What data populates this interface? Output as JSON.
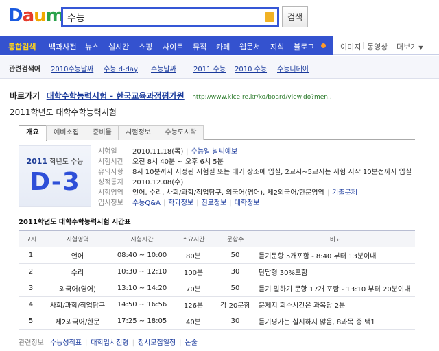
{
  "logo": {
    "d": "D",
    "a": "a",
    "u": "u",
    "m": "m"
  },
  "search": {
    "value": "수능",
    "button": "검색"
  },
  "nav": {
    "items": [
      "통합검색",
      "백과사전",
      "뉴스",
      "실시간",
      "쇼핑",
      "사이트",
      "뮤직",
      "카페",
      "웹문서",
      "지식",
      "블로그"
    ],
    "extra": [
      "이미지",
      "동영상",
      "더보기"
    ]
  },
  "related": {
    "label": "관련검색어",
    "links": [
      "2010수능날짜",
      "수능 d-day",
      "수능날짜",
      "2011 수능",
      "2010 수능",
      "수능디데이"
    ]
  },
  "shortcut": {
    "label": "바로가기",
    "link": "대학수학능력시험 - 한국교육과정평가원",
    "url": "http://www.kice.re.kr/ko/board/view.do?men.."
  },
  "title": "2011학년도 대학수학능력시험",
  "tabs": [
    "개요",
    "예비소집",
    "준비물",
    "시험정보",
    "수능도시락"
  ],
  "dday": {
    "year": "2011",
    "label": "학년도 수능",
    "count": "D-3"
  },
  "info": {
    "date_label": "시험일",
    "date_value": "2010.11.18(목)",
    "date_link": "수능일 날씨예보",
    "time_label": "시험시간",
    "time_value": "오전 8시 40분 ~ 오후 6시 5분",
    "notice_label": "유의사항",
    "notice_value": "8시 10분까지 지정된 시험실 또는 대기 장소에 입실, 2교시~5교시는 시험 시작 10분전까지 입실",
    "result_label": "성적통지",
    "result_value": "2010.12.08(수)",
    "area_label": "시험영역",
    "area_value": "언어, 수리, 사회/과학/직업탐구, 외국어(영어), 제2외국어/한문영역",
    "area_link": "기출문제",
    "admission_label": "입시정보",
    "admission_links": [
      "수능Q&A",
      "학과정보",
      "진로정보",
      "대학정보"
    ]
  },
  "schedule": {
    "title": "2011학년도 대학수학능력시험 시간표",
    "headers": [
      "교시",
      "시험영역",
      "시험시간",
      "소요시간",
      "문항수",
      "비고"
    ],
    "rows": [
      [
        "1",
        "언어",
        "08:40 ~ 10:00",
        "80분",
        "50",
        "듣기문항 5개포함 - 8:40 부터 13분이내"
      ],
      [
        "2",
        "수리",
        "10:30 ~ 12:10",
        "100분",
        "30",
        "단답형 30%포함"
      ],
      [
        "3",
        "외국어(영어)",
        "13:10 ~ 14:20",
        "70분",
        "50",
        "듣기 말하기 문항 17개 포함 - 13:10 부터 20분이내"
      ],
      [
        "4",
        "사회/과학/직업탐구",
        "14:50 ~ 16:56",
        "126분",
        "각 20문항",
        "문제지 회수시간은 과목당 2분"
      ],
      [
        "5",
        "제2외국어/한문",
        "17:25 ~ 18:05",
        "40분",
        "30",
        "듣기평가는 실시하지 않음, 8과목 중 택1"
      ]
    ]
  },
  "footer": {
    "label": "관련정보",
    "links": [
      "수능성적표",
      "대학입시전형",
      "정시모집일정",
      "논술"
    ]
  },
  "colors": {
    "accent": "#3452cf",
    "active_nav": "#ffd41c",
    "link": "#1a3a9c"
  }
}
